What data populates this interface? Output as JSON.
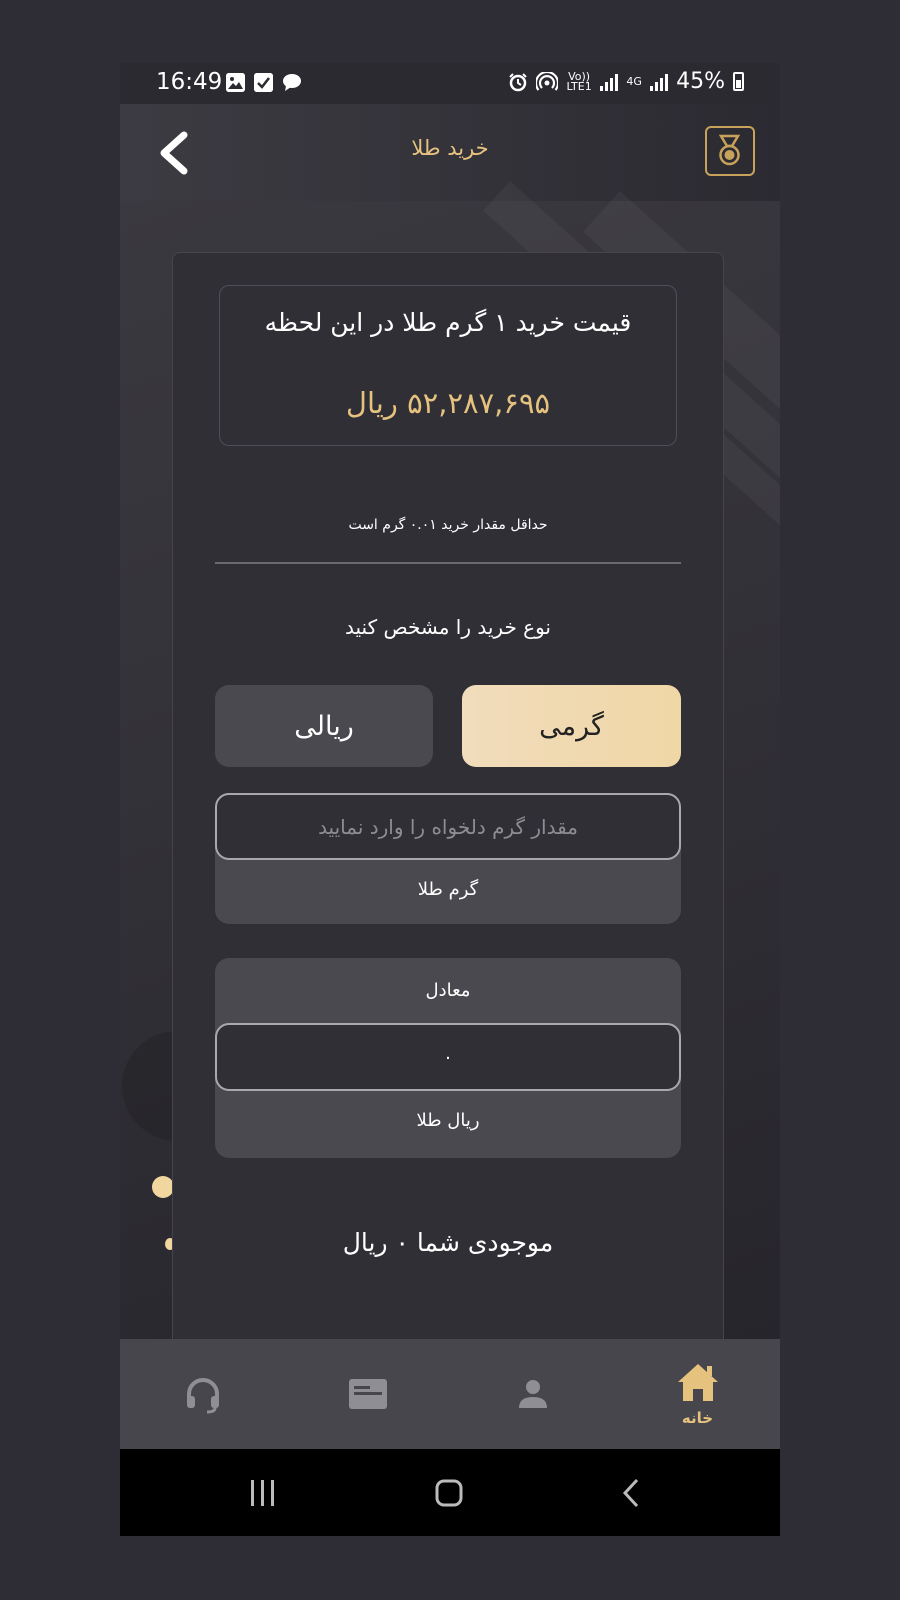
{
  "status_bar": {
    "time": "16:49",
    "battery": "45%",
    "network": "4G",
    "volte": "Vo)) LTE1",
    "icons_left": [
      "image-icon",
      "check-icon",
      "chat-icon"
    ],
    "icons_right": [
      "alarm-icon",
      "hotspot-icon",
      "volte-icon",
      "signal-icon",
      "4g-icon",
      "signal-icon",
      "battery-icon"
    ]
  },
  "header": {
    "title": "خرید طلا",
    "back_icon": "chevron-left-icon",
    "logo_icon": "gold-medal-logo-icon"
  },
  "price": {
    "label": "قیمت خرید ۱ گرم طلا در این لحظه",
    "value": "۵۲,۲۸۷,۶۹۵ ریال"
  },
  "min_note": "حداقل مقدار خرید ۰.۰۱ گرم است",
  "purchase_type": {
    "label": "نوع خرید را مشخص کنید",
    "options": [
      {
        "label": "گرمی",
        "selected": true
      },
      {
        "label": "ریالی",
        "selected": false
      }
    ]
  },
  "gram_input": {
    "placeholder": "مقدار گرم دلخواه را وارد نمایید",
    "value": "",
    "unit": "گرم طلا"
  },
  "equivalent": {
    "label": "معادل",
    "value": "۰",
    "unit": "ریال طلا"
  },
  "balance": "موجودی شما ۰ ریال",
  "bottom_nav": [
    {
      "icon": "headset-icon",
      "label": ""
    },
    {
      "icon": "card-icon",
      "label": ""
    },
    {
      "icon": "person-icon",
      "label": ""
    },
    {
      "icon": "home-icon",
      "label": "خانه",
      "active": true
    }
  ],
  "colors": {
    "accent": "#e6c27f",
    "background": "#2e2d35",
    "card": "#302f36",
    "selected_button": "#f0d7a6",
    "unselected_button": "#4a4950",
    "nav_bar": "#47464d"
  }
}
